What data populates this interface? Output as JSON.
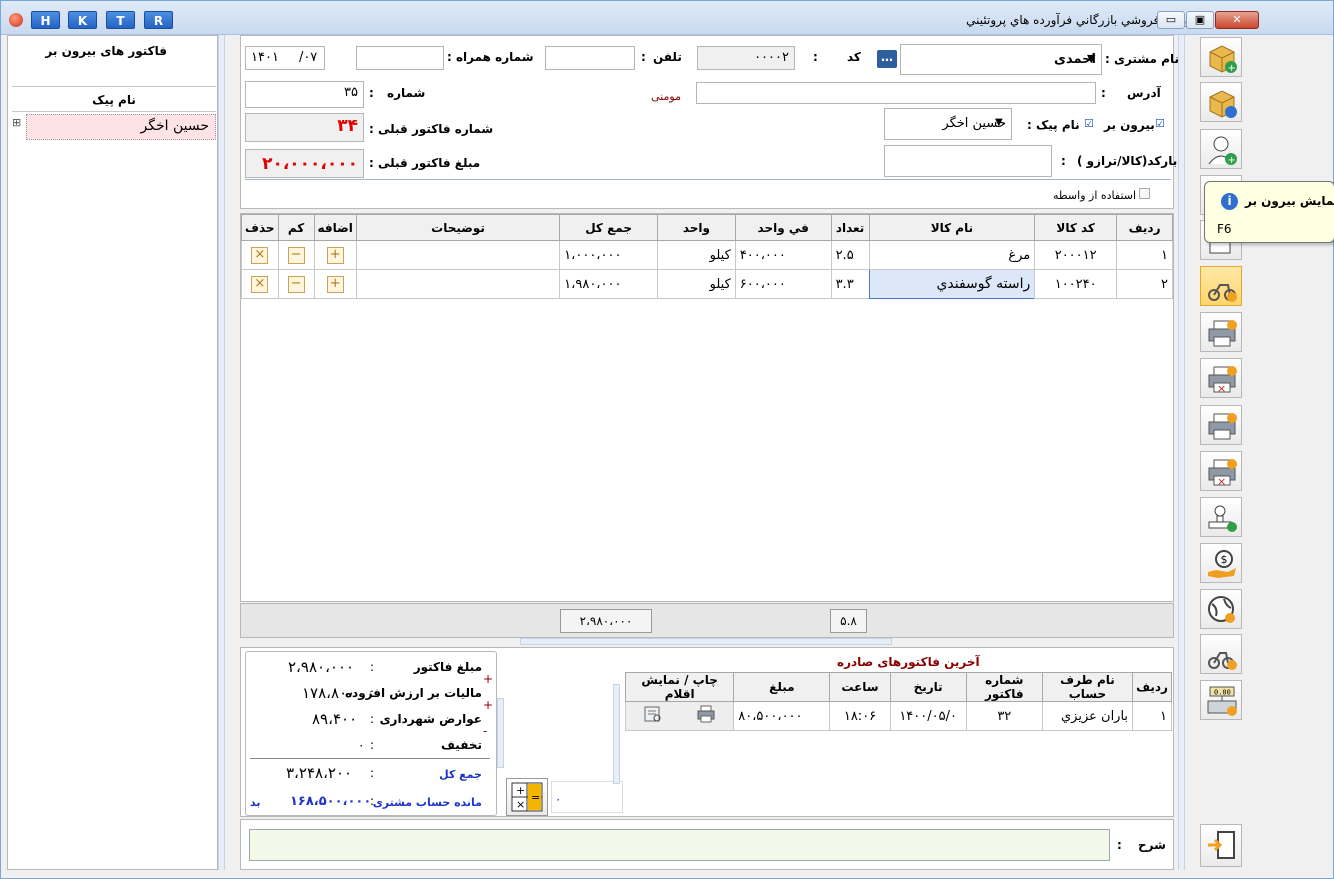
{
  "titlebar": {
    "app_buttons": [
      "H",
      "K",
      "T",
      "R"
    ],
    "title": "فاكتور تك فروشي بازرگاني فرآورده هاي پروتئيني",
    "minimize": "▭",
    "restore": "▣",
    "close": "✕"
  },
  "left_panel": {
    "title": "فاكتور های بیرون بر",
    "column_header": "نام پیک",
    "expand_glyph": "⊞",
    "items": [
      "حسین اخگر"
    ]
  },
  "header_form": {
    "date_year": "۱۴۰۱",
    "date_month": "/۰۷",
    "mobile_label": "شماره همراه :",
    "mobile_value": "",
    "phone_label": "تلفن",
    "phone_colon": ":",
    "phone_value": "",
    "code_value": "۰۰۰۰۲",
    "code_colon": ":",
    "code_label": "کد",
    "lookup_button": "…",
    "customer_label": "نام مشتری :",
    "customer_value": "احمدی",
    "number_label": "شماره",
    "number_colon": ":",
    "number_value": "۳۵",
    "address_label": "آدرس",
    "address_colon": ":",
    "address_hint": "مومنی",
    "address_value": "",
    "prev_invoice_no_label": "شماره فاكتور قبلی :",
    "prev_invoice_no_value": "۳۴",
    "courier_check_label": "بیرون بر",
    "courier_name_label": "نام پیک :",
    "courier_name_value": "حسین اخگر",
    "prev_invoice_amount_label": "مبلغ فاكتور قبلی :",
    "prev_invoice_amount_value": "۲۰،۰۰۰،۰۰۰",
    "barcode_label": "بارکد(کالا/ترازو )",
    "barcode_colon": ":",
    "barcode_value": "",
    "intermediary_label": "استفاده از واسطه"
  },
  "items_grid": {
    "headers": [
      "ردیف",
      "کد کالا",
      "نام کالا",
      "تعداد",
      "في واحد",
      "واحد",
      "جمع کل",
      "توضیحات",
      "اضافه",
      "کم",
      "حذف"
    ],
    "rows": [
      {
        "row": "۱",
        "code": "۲۰۰۰۱۲",
        "name": "مرغ",
        "qty": "۲.۵",
        "unit_price": "۴۰۰،۰۰۰",
        "unit": "کیلو",
        "total": "۱،۰۰۰،۰۰۰",
        "desc": ""
      },
      {
        "row": "۲",
        "code": "۱۰۰۲۴۰",
        "name": "راسته گوسفندي",
        "qty": "۳.۳",
        "unit_price": "۶۰۰،۰۰۰",
        "unit": "کیلو",
        "total": "۱،۹۸۰،۰۰۰",
        "desc": ""
      }
    ],
    "add_glyph": "+",
    "minus_glyph": "−",
    "delete_glyph": "×",
    "footer_total": "۲،۹۸۰،۰۰۰",
    "footer_qty": "۵.۸"
  },
  "summary": {
    "rows": [
      {
        "label": "مبلغ فاكتور",
        "value": "۲،۹۸۰،۰۰۰",
        "sign": "+"
      },
      {
        "label": "مالیات بر ارزش افزوده",
        "value": "۱۷۸،۸۰۰",
        "sign": "+"
      },
      {
        "label": "عوارض شهرداری",
        "value": "۸۹،۴۰۰",
        "sign": "-"
      },
      {
        "label": "تخفیف",
        "value": "۰",
        "sign": ""
      }
    ],
    "total_label": "جمع کل",
    "total_value": "۳،۲۴۸،۲۰۰",
    "balance_label": "مانده حساب مشتری",
    "balance_value": "۱۶۸،۵۰۰،۰۰۰",
    "balance_flag": "بد",
    "side_value": "۰"
  },
  "recent_invoices": {
    "title": "آخرین فاكتورهای صادره",
    "headers": [
      "ردیف",
      "نام طرف حساب",
      "شماره فاكتور",
      "تاریخ",
      "ساعت",
      "مبلغ",
      "چاپ / نمایش اقلام"
    ],
    "rows": [
      {
        "row": "۱",
        "party": "باران عزیزي",
        "invoice_no": "۳۲",
        "date": "۱۴۰۰/۰۵/۰",
        "time": "۱۸:۰۶",
        "amount": "۸۰،۵۰۰،۰۰۰"
      }
    ]
  },
  "description": {
    "label": "شرح",
    "colon": ":",
    "value": ""
  },
  "tooltip": {
    "title": "نمایش بیرون بر",
    "shortcut": "F6"
  },
  "colors": {
    "accent_blue": "#1f35c9",
    "error_red": "#e00000",
    "dark_red": "#8b0000",
    "tooltip_bg": "#ffffe1"
  }
}
